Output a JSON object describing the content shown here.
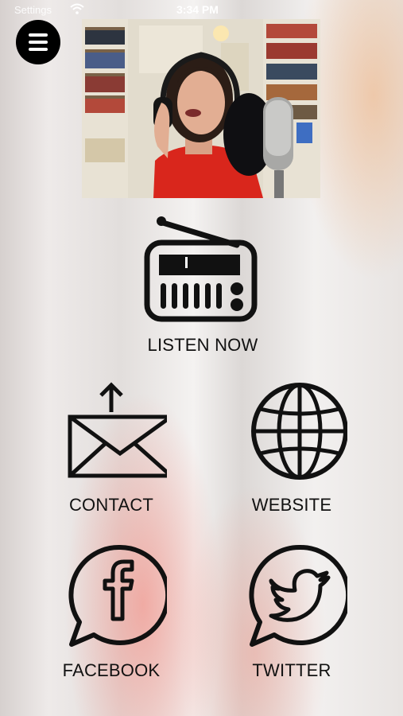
{
  "status_bar": {
    "back_label": "Settings",
    "time": "3:34 PM"
  },
  "hero": {
    "alt": "Host singing into studio microphone"
  },
  "menu": {
    "icon": "hamburger-menu-icon"
  },
  "tiles": {
    "listen": {
      "label": "LISTEN NOW",
      "icon": "radio-icon"
    },
    "contact": {
      "label": "CONTACT",
      "icon": "envelope-upload-icon"
    },
    "website": {
      "label": "WEBSITE",
      "icon": "globe-icon"
    },
    "facebook": {
      "label": "FACEBOOK",
      "icon": "facebook-bubble-icon"
    },
    "twitter": {
      "label": "TWITTER",
      "icon": "twitter-bubble-icon"
    }
  },
  "colors": {
    "icon_stroke": "#111111",
    "accent_red": "#d9261c",
    "menu_button": "#000000"
  }
}
